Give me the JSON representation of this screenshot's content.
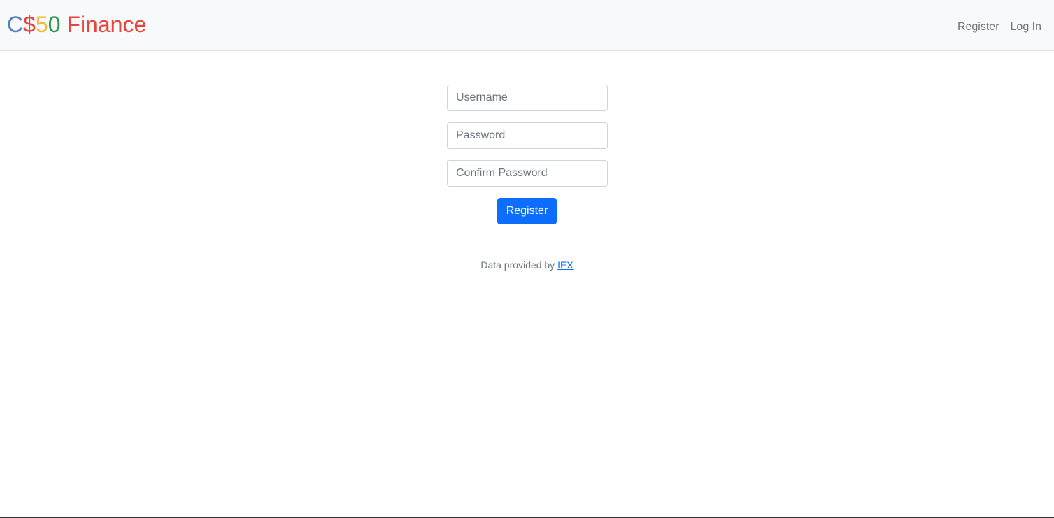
{
  "brand": {
    "part1": "C",
    "part2": "$",
    "part3": "5",
    "part4": "0",
    "part5": " Finance",
    "colors": {
      "blue": "#537fbe",
      "red": "#ea433b",
      "yellow": "#f5b82e",
      "green": "#2e944b"
    }
  },
  "nav": {
    "register_label": "Register",
    "login_label": "Log In"
  },
  "form": {
    "username_placeholder": "Username",
    "password_placeholder": "Password",
    "confirm_placeholder": "Confirm Password",
    "username_value": "",
    "password_value": "",
    "confirm_value": "",
    "submit_label": "Register",
    "accent_color": "#0d6efd"
  },
  "footer": {
    "prefix": "Data provided by ",
    "link_label": "IEX"
  }
}
